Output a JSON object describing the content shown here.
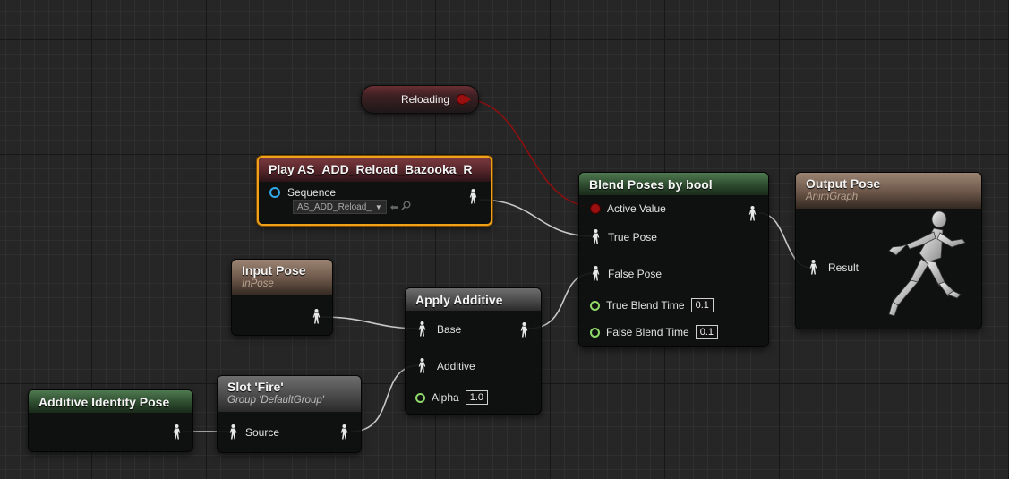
{
  "colors": {
    "pose_wire": "#c8c8c8",
    "bool_wire": "#8a1010",
    "float_pin": "#8fd96a",
    "sequence_pin": "#33a8e8",
    "selection": "#f0a11a"
  },
  "nodes": {
    "reloading": {
      "label": "Reloading"
    },
    "play": {
      "title": "Play AS_ADD_Reload_Bazooka_R",
      "sequence_label": "Sequence",
      "sequence_value": "AS_ADD_Reload_",
      "browse_icon": "arrow-left-icon",
      "find_icon": "search-icon"
    },
    "blend": {
      "title": "Blend Poses by bool",
      "active_value": "Active Value",
      "true_pose": "True Pose",
      "false_pose": "False Pose",
      "true_blend_label": "True Blend Time",
      "true_blend_value": "0.1",
      "false_blend_label": "False Blend Time",
      "false_blend_value": "0.1"
    },
    "output": {
      "title": "Output Pose",
      "subtitle": "AnimGraph",
      "result": "Result",
      "icon": "running-mannequin-icon"
    },
    "input_pose": {
      "title": "Input Pose",
      "subtitle": "InPose"
    },
    "apply_additive": {
      "title": "Apply Additive",
      "base": "Base",
      "additive": "Additive",
      "alpha_label": "Alpha",
      "alpha_value": "1.0"
    },
    "identity": {
      "title": "Additive Identity Pose"
    },
    "slot": {
      "title": "Slot 'Fire'",
      "subtitle": "Group 'DefaultGroup'",
      "source": "Source"
    }
  }
}
